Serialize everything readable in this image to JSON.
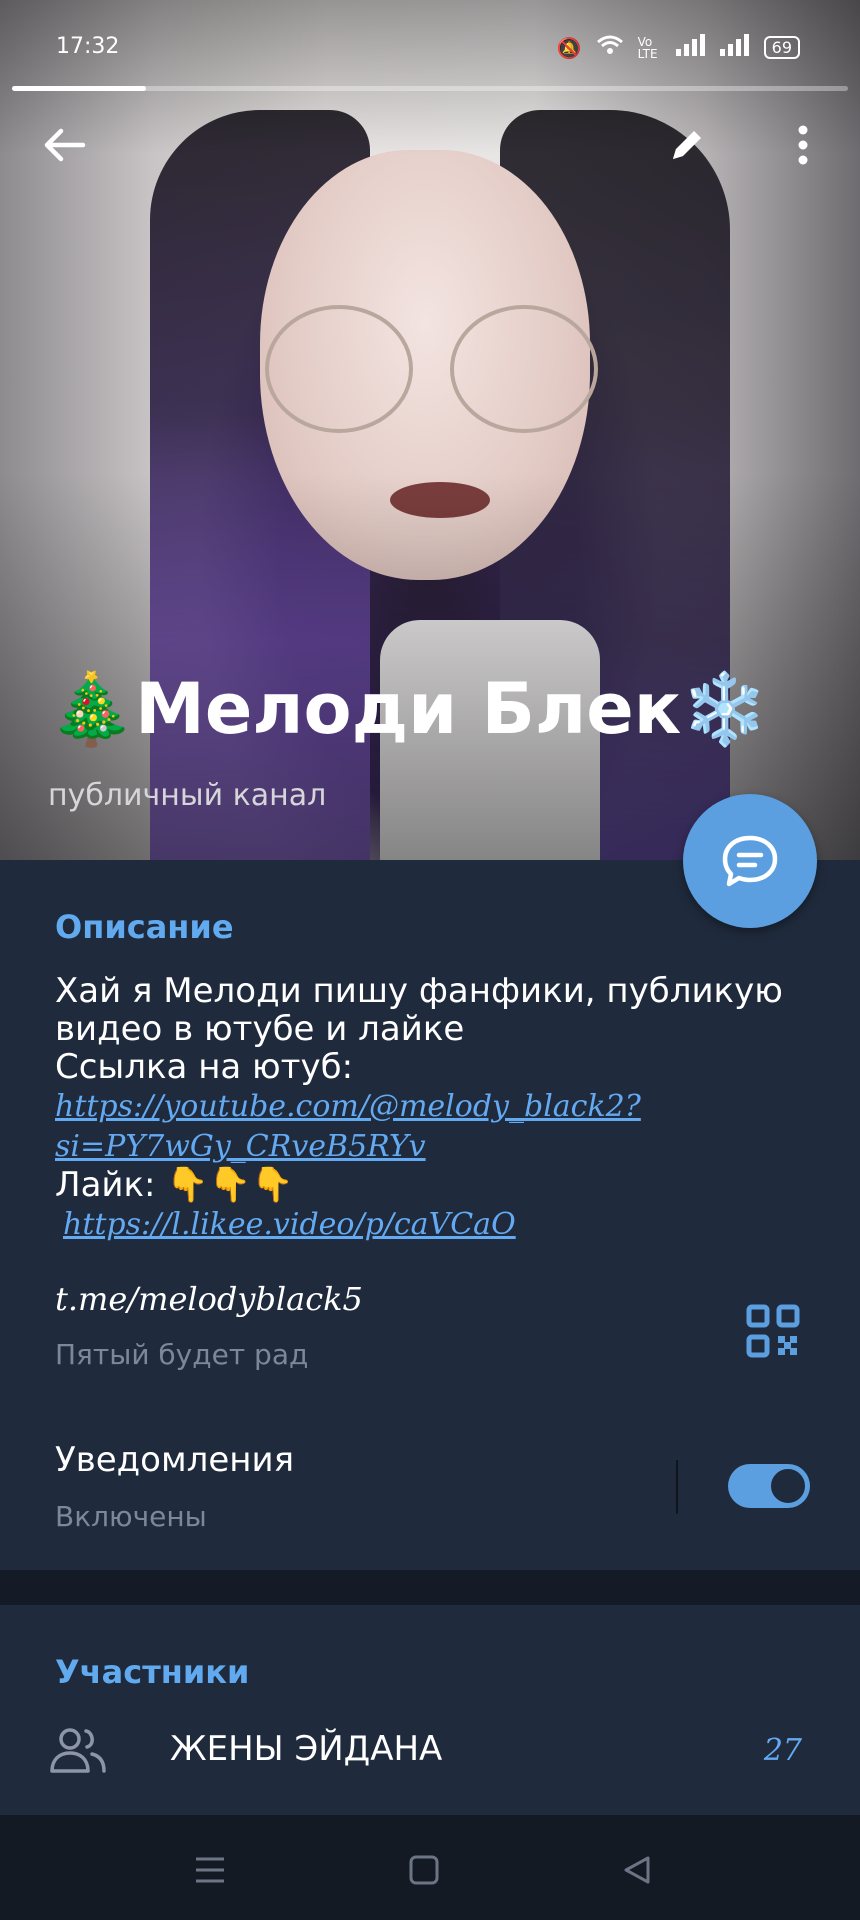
{
  "status_bar": {
    "time": "17:32",
    "network": "Vo LTE",
    "battery": "69"
  },
  "story_progress": 0.16,
  "header": {
    "title": "🎄Мелоди Блек❄️",
    "subtitle": "публичный канал"
  },
  "description": {
    "section_title": "Описание",
    "line1": "Хай я Мелоди пишу фанфики, публикую видео в ютубе и лайке",
    "line2": "Ссылка на ютуб:",
    "youtube_link": "https://youtube.com/@melody_black2?si=PY7wGy_CRveB5RYv",
    "line3": "Лайк:  👇👇👇",
    "likee_link": "https://l.likee.video/p/caVCaO"
  },
  "channel_link": {
    "url": "t.me/melodyblack5",
    "caption": "Пятый будет рад"
  },
  "notifications": {
    "title": "Уведомления",
    "status": "Включены",
    "enabled": true
  },
  "members": {
    "section_title": "Участники",
    "row_name": "ЖЕНЫ ЭЙДАНА",
    "row_count": "27"
  },
  "icons": {
    "back": "arrow-left-icon",
    "edit": "pencil-icon",
    "more": "more-vertical-icon",
    "fab": "chat-bubble-icon",
    "qr": "qr-code-icon",
    "members": "people-icon"
  },
  "colors": {
    "accent": "#5b9fe0",
    "link": "#64aaf2",
    "panel": "#1f2a3c"
  }
}
